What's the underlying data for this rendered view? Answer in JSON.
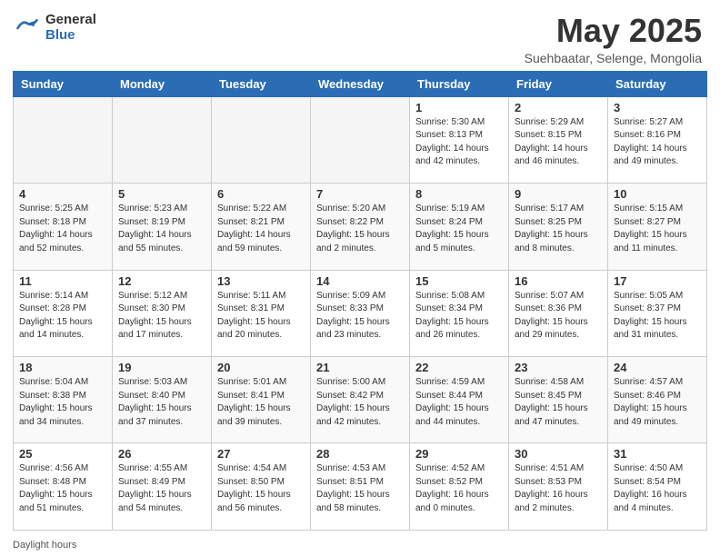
{
  "header": {
    "logo_general": "General",
    "logo_blue": "Blue",
    "month_title": "May 2025",
    "subtitle": "Suehbaatar, Selenge, Mongolia"
  },
  "days_of_week": [
    "Sunday",
    "Monday",
    "Tuesday",
    "Wednesday",
    "Thursday",
    "Friday",
    "Saturday"
  ],
  "weeks": [
    [
      {
        "num": "",
        "info": "",
        "empty": true
      },
      {
        "num": "",
        "info": "",
        "empty": true
      },
      {
        "num": "",
        "info": "",
        "empty": true
      },
      {
        "num": "",
        "info": "",
        "empty": true
      },
      {
        "num": "1",
        "info": "Sunrise: 5:30 AM\nSunset: 8:13 PM\nDaylight: 14 hours\nand 42 minutes.",
        "empty": false
      },
      {
        "num": "2",
        "info": "Sunrise: 5:29 AM\nSunset: 8:15 PM\nDaylight: 14 hours\nand 46 minutes.",
        "empty": false
      },
      {
        "num": "3",
        "info": "Sunrise: 5:27 AM\nSunset: 8:16 PM\nDaylight: 14 hours\nand 49 minutes.",
        "empty": false
      }
    ],
    [
      {
        "num": "4",
        "info": "Sunrise: 5:25 AM\nSunset: 8:18 PM\nDaylight: 14 hours\nand 52 minutes.",
        "empty": false
      },
      {
        "num": "5",
        "info": "Sunrise: 5:23 AM\nSunset: 8:19 PM\nDaylight: 14 hours\nand 55 minutes.",
        "empty": false
      },
      {
        "num": "6",
        "info": "Sunrise: 5:22 AM\nSunset: 8:21 PM\nDaylight: 14 hours\nand 59 minutes.",
        "empty": false
      },
      {
        "num": "7",
        "info": "Sunrise: 5:20 AM\nSunset: 8:22 PM\nDaylight: 15 hours\nand 2 minutes.",
        "empty": false
      },
      {
        "num": "8",
        "info": "Sunrise: 5:19 AM\nSunset: 8:24 PM\nDaylight: 15 hours\nand 5 minutes.",
        "empty": false
      },
      {
        "num": "9",
        "info": "Sunrise: 5:17 AM\nSunset: 8:25 PM\nDaylight: 15 hours\nand 8 minutes.",
        "empty": false
      },
      {
        "num": "10",
        "info": "Sunrise: 5:15 AM\nSunset: 8:27 PM\nDaylight: 15 hours\nand 11 minutes.",
        "empty": false
      }
    ],
    [
      {
        "num": "11",
        "info": "Sunrise: 5:14 AM\nSunset: 8:28 PM\nDaylight: 15 hours\nand 14 minutes.",
        "empty": false
      },
      {
        "num": "12",
        "info": "Sunrise: 5:12 AM\nSunset: 8:30 PM\nDaylight: 15 hours\nand 17 minutes.",
        "empty": false
      },
      {
        "num": "13",
        "info": "Sunrise: 5:11 AM\nSunset: 8:31 PM\nDaylight: 15 hours\nand 20 minutes.",
        "empty": false
      },
      {
        "num": "14",
        "info": "Sunrise: 5:09 AM\nSunset: 8:33 PM\nDaylight: 15 hours\nand 23 minutes.",
        "empty": false
      },
      {
        "num": "15",
        "info": "Sunrise: 5:08 AM\nSunset: 8:34 PM\nDaylight: 15 hours\nand 26 minutes.",
        "empty": false
      },
      {
        "num": "16",
        "info": "Sunrise: 5:07 AM\nSunset: 8:36 PM\nDaylight: 15 hours\nand 29 minutes.",
        "empty": false
      },
      {
        "num": "17",
        "info": "Sunrise: 5:05 AM\nSunset: 8:37 PM\nDaylight: 15 hours\nand 31 minutes.",
        "empty": false
      }
    ],
    [
      {
        "num": "18",
        "info": "Sunrise: 5:04 AM\nSunset: 8:38 PM\nDaylight: 15 hours\nand 34 minutes.",
        "empty": false
      },
      {
        "num": "19",
        "info": "Sunrise: 5:03 AM\nSunset: 8:40 PM\nDaylight: 15 hours\nand 37 minutes.",
        "empty": false
      },
      {
        "num": "20",
        "info": "Sunrise: 5:01 AM\nSunset: 8:41 PM\nDaylight: 15 hours\nand 39 minutes.",
        "empty": false
      },
      {
        "num": "21",
        "info": "Sunrise: 5:00 AM\nSunset: 8:42 PM\nDaylight: 15 hours\nand 42 minutes.",
        "empty": false
      },
      {
        "num": "22",
        "info": "Sunrise: 4:59 AM\nSunset: 8:44 PM\nDaylight: 15 hours\nand 44 minutes.",
        "empty": false
      },
      {
        "num": "23",
        "info": "Sunrise: 4:58 AM\nSunset: 8:45 PM\nDaylight: 15 hours\nand 47 minutes.",
        "empty": false
      },
      {
        "num": "24",
        "info": "Sunrise: 4:57 AM\nSunset: 8:46 PM\nDaylight: 15 hours\nand 49 minutes.",
        "empty": false
      }
    ],
    [
      {
        "num": "25",
        "info": "Sunrise: 4:56 AM\nSunset: 8:48 PM\nDaylight: 15 hours\nand 51 minutes.",
        "empty": false
      },
      {
        "num": "26",
        "info": "Sunrise: 4:55 AM\nSunset: 8:49 PM\nDaylight: 15 hours\nand 54 minutes.",
        "empty": false
      },
      {
        "num": "27",
        "info": "Sunrise: 4:54 AM\nSunset: 8:50 PM\nDaylight: 15 hours\nand 56 minutes.",
        "empty": false
      },
      {
        "num": "28",
        "info": "Sunrise: 4:53 AM\nSunset: 8:51 PM\nDaylight: 15 hours\nand 58 minutes.",
        "empty": false
      },
      {
        "num": "29",
        "info": "Sunrise: 4:52 AM\nSunset: 8:52 PM\nDaylight: 16 hours\nand 0 minutes.",
        "empty": false
      },
      {
        "num": "30",
        "info": "Sunrise: 4:51 AM\nSunset: 8:53 PM\nDaylight: 16 hours\nand 2 minutes.",
        "empty": false
      },
      {
        "num": "31",
        "info": "Sunrise: 4:50 AM\nSunset: 8:54 PM\nDaylight: 16 hours\nand 4 minutes.",
        "empty": false
      }
    ]
  ],
  "footer": {
    "note": "Daylight hours"
  }
}
